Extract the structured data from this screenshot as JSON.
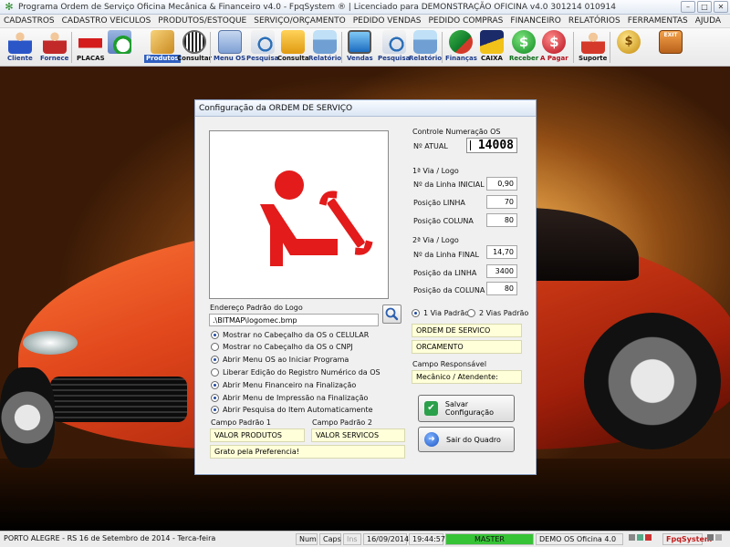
{
  "window": {
    "title": "Programa Ordem de Serviço Oficina Mecânica & Financeiro v4.0 - FpqSystem ® | Licenciado para  DEMONSTRAÇÃO OFICINA v4.0 301214 010914"
  },
  "menu": [
    "CADASTROS",
    "CADASTRO VEICULOS",
    "PRODUTOS/ESTOQUE",
    "SERVIÇO/ORÇAMENTO",
    "PEDIDO VENDAS",
    "PEDIDO COMPRAS",
    "FINANCEIRO",
    "RELATÓRIOS",
    "FERRAMENTAS",
    "AJUDA"
  ],
  "toolbar": {
    "cliente": "Cliente",
    "fornece": "Fornece",
    "placas": "PLACAS",
    "produtos": "Produtos",
    "consultar": "Consultar",
    "menu_os": "Menu OS",
    "pesquisa1": "Pesquisa",
    "consulta": "Consulta",
    "relatorio1": "Relatório",
    "vendas": "Vendas",
    "pesquisa2": "Pesquisa",
    "relatorio2": "Relatório",
    "financas": "Finanças",
    "caixa": "CAIXA",
    "receber": "Receber",
    "a_pagar": "A Pagar",
    "suporte": "Suporte"
  },
  "dialog": {
    "title": "Configuração da ORDEM DE SERVIÇO",
    "logo_label": "Endereço Padrão do Logo",
    "logo_path": ".\\BITMAP\\logomec.bmp",
    "options": [
      {
        "label": "Mostrar no Cabeçalho da OS o CELULAR",
        "on": true
      },
      {
        "label": "Mostrar no Cabeçalho da OS o CNPJ",
        "on": false
      },
      {
        "label": "Abrir Menu OS ao Iniciar Programa",
        "on": true
      },
      {
        "label": "Liberar Edição do Registro Numérico da OS",
        "on": false
      },
      {
        "label": "Abrir Menu Financeiro na Finalização",
        "on": true
      },
      {
        "label": "Abrir Menu de Impressão na Finalização",
        "on": true
      },
      {
        "label": "Abrir Pesquisa do Item Automaticamente",
        "on": true
      }
    ],
    "campo1_label": "Campo Padrão 1",
    "campo2_label": "Campo Padrão 2",
    "campo1_value": "VALOR PRODUTOS",
    "campo2_value": "VALOR SERVICOS",
    "footer_text": "Grato pela Preferencia!",
    "controle_label": "Controle Numeração OS",
    "natual_label": "Nº ATUAL",
    "natual_value": "14008",
    "via1_label": "1ª Via / Logo",
    "via1_fields": [
      {
        "label": "Nº da Linha INICIAL",
        "value": "0,90"
      },
      {
        "label": "Posição LINHA",
        "value": "70"
      },
      {
        "label": "Posição COLUNA",
        "value": "80"
      }
    ],
    "via2_label": "2ª Via / Logo",
    "via2_fields": [
      {
        "label": "Nº da Linha FINAL",
        "value": "14,70"
      },
      {
        "label": "Posição da LINHA",
        "value": "3400"
      },
      {
        "label": "Posição da COLUNA",
        "value": "80"
      }
    ],
    "via_radio1": "1 Via Padrão",
    "via_radio2": "2 Vias Padrão",
    "ordem_servico": "ORDEM DE SERVICO",
    "orcamento": "ORCAMENTO",
    "responsavel_label": "Campo Responsável",
    "responsavel_value": "Mecânico / Atendente:",
    "save_label": "Salvar Configuração",
    "exit_label": "Sair do Quadro"
  },
  "status": {
    "location": "PORTO ALEGRE - RS 16 de Setembro de 2014 - Terca-feira",
    "num": "Num",
    "caps": "Caps",
    "ins": "Ins",
    "date": "16/09/2014",
    "time": "19:44:57",
    "master": "MASTER",
    "demo": "DEMO OS Oficina 4.0",
    "brand": "FpqSystem"
  },
  "colors": {
    "accent_red": "#e31b1b",
    "status_green": "#36c336",
    "input_yellow": "#ffffd9"
  }
}
